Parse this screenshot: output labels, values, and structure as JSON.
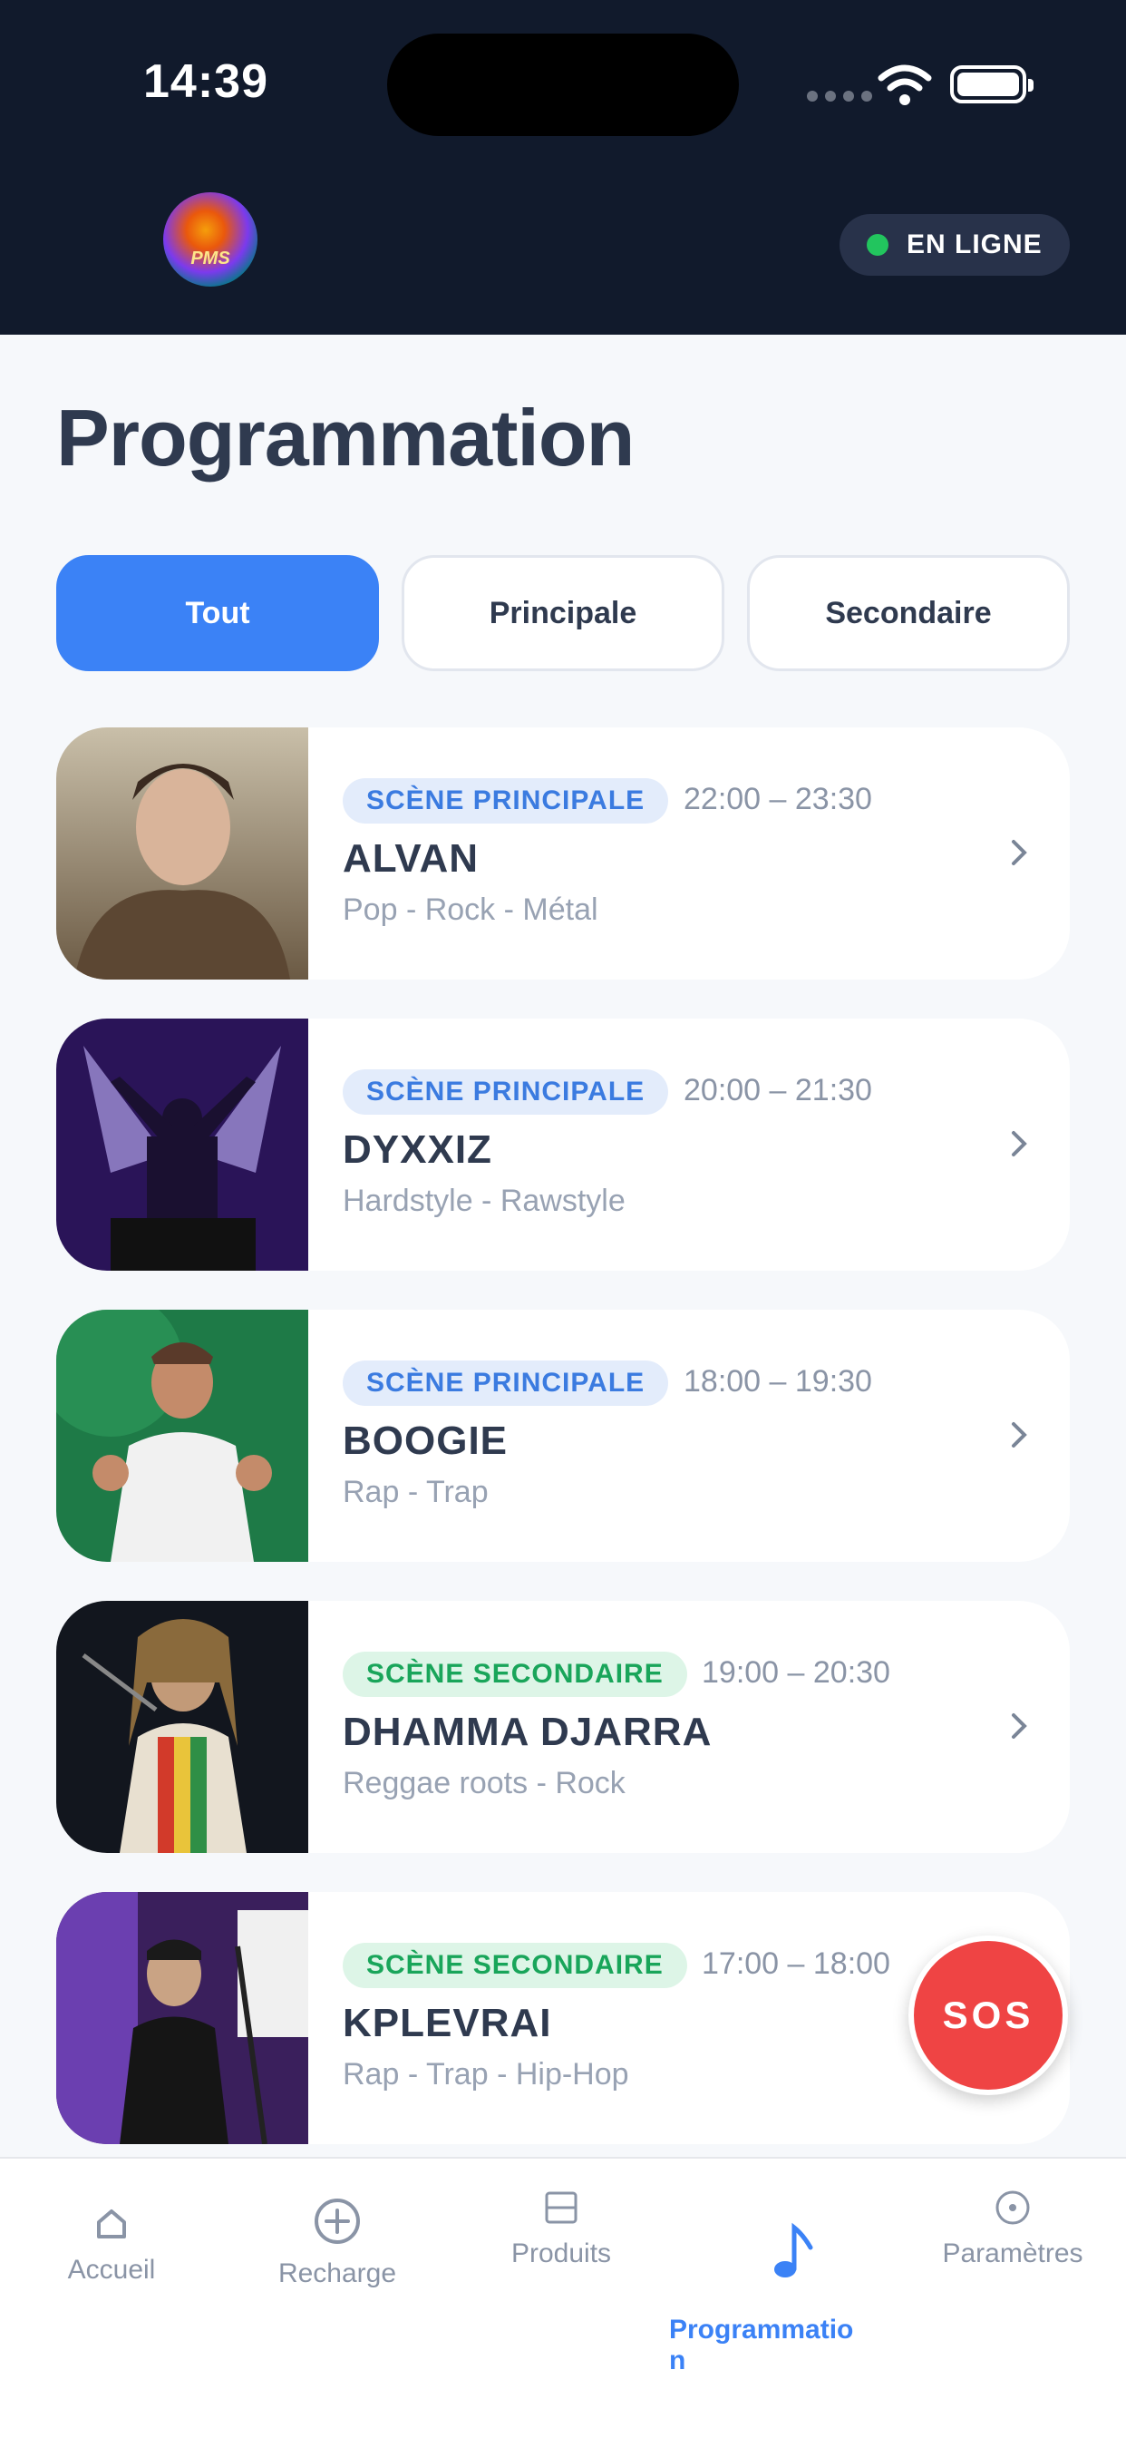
{
  "status_bar": {
    "time": "14:39"
  },
  "header": {
    "logo_text": "PMS",
    "online_label": "EN LIGNE"
  },
  "page": {
    "title": "Programmation"
  },
  "filters": [
    {
      "label": "Tout"
    },
    {
      "label": "Principale"
    },
    {
      "label": "Secondaire"
    }
  ],
  "events": [
    {
      "stage": "SCÈNE PRINCIPALE",
      "time": "22:00 – 23:30",
      "artist": "ALVAN",
      "genre": "Pop - Rock - Métal"
    },
    {
      "stage": "SCÈNE PRINCIPALE",
      "time": "20:00 – 21:30",
      "artist": "DYXXIZ",
      "genre": "Hardstyle - Rawstyle"
    },
    {
      "stage": "SCÈNE PRINCIPALE",
      "time": "18:00 – 19:30",
      "artist": "BOOGIE",
      "genre": "Rap - Trap"
    },
    {
      "stage": "SCÈNE SECONDAIRE",
      "time": "19:00 – 20:30",
      "artist": "DHAMMA DJARRA",
      "genre": "Reggae roots - Rock"
    },
    {
      "stage": "SCÈNE SECONDAIRE",
      "time": "17:00 – 18:00",
      "artist": "KPLEVRAI",
      "genre": "Rap - Trap - Hip-Hop"
    }
  ],
  "sos": {
    "label": "SOS"
  },
  "tabbar": [
    {
      "label": "Accueil",
      "icon": "home-icon"
    },
    {
      "label": "Recharge",
      "icon": "plus-circle-icon"
    },
    {
      "label": "Produits",
      "icon": "box-icon"
    },
    {
      "label": "Programmatio\nn",
      "icon": "music-note-icon"
    },
    {
      "label": "Paramètres",
      "icon": "settings-circle-icon"
    }
  ],
  "colors": {
    "accent": "#3b82f6",
    "header_bg": "#111a2c",
    "sos": "#ef4444",
    "online": "#22c55e"
  }
}
